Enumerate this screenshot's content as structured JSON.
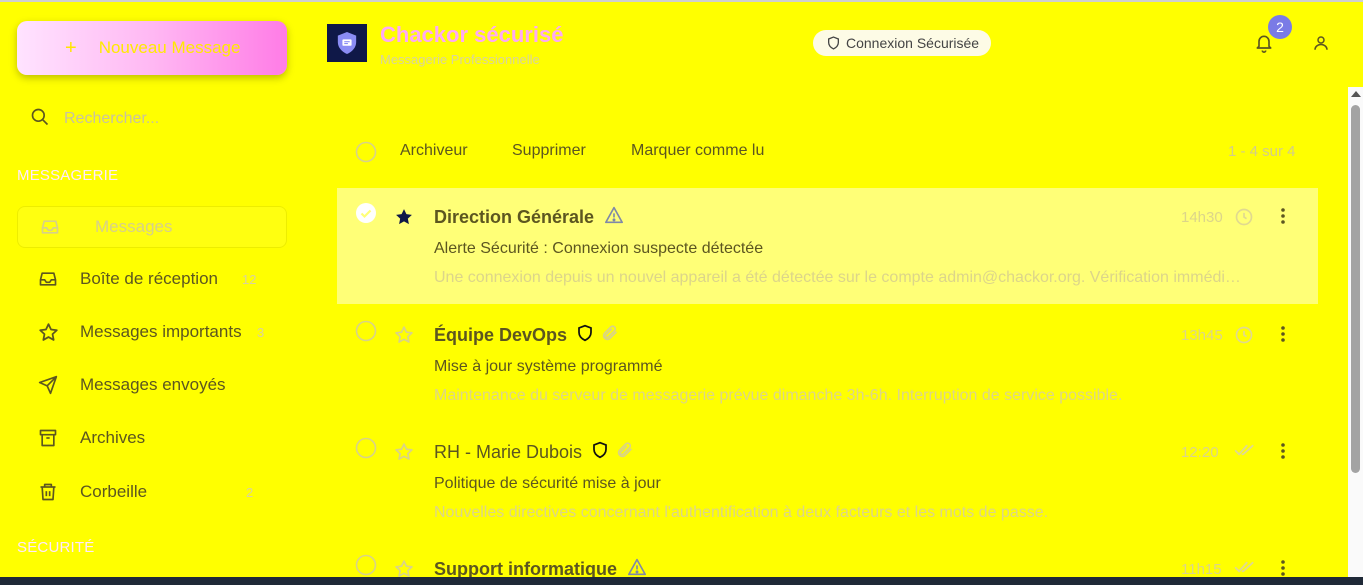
{
  "app": {
    "title": "Chackor sécurisé",
    "subtitle": "Messagerie Professionnelle",
    "security_status": "Connexion Sécurisée",
    "notification_count": "2"
  },
  "sidebar": {
    "compose_plus": "+",
    "compose_label": "Nouveau Message",
    "search_placeholder": "Rechercher...",
    "section_messaging": "MESSAGERIE",
    "section_security": "SÉCURITÉ",
    "items": [
      {
        "label": "Messages",
        "count": "",
        "icon": "inbox-icon",
        "active": true
      },
      {
        "label": "Boîte de réception",
        "count": "12",
        "icon": "inbox-icon"
      },
      {
        "label": "Messages importants",
        "count": "3",
        "icon": "star-icon"
      },
      {
        "label": "Messages envoyés",
        "count": "",
        "icon": "send-icon"
      },
      {
        "label": "Archives",
        "count": "",
        "icon": "archive-icon"
      },
      {
        "label": "Corbeille",
        "count": "2",
        "icon": "trash-icon"
      }
    ]
  },
  "toolbar": {
    "archive_label": "Archiveur",
    "delete_label": "Supprimer",
    "mark_read_label": "Marquer comme lu",
    "pagination": "1 - 4 sur 4"
  },
  "messages": [
    {
      "sender": "Direction Générale",
      "subject": "Alerte Sécurité : Connexion suspecte détectée",
      "preview": "Une connexion depuis un nouvel appareil a été détectée sur le compte admin@chackor.org. Vérification immédiate requise.",
      "time": "14h30",
      "starred": true,
      "selected": true,
      "tags": [
        "warning-icon"
      ],
      "status": "clock-icon"
    },
    {
      "sender": "Équipe DevOps",
      "subject": "Mise à jour système programmé",
      "preview": "Maintenance du serveur de messagerie prévue dimanche 3h-6h. Interruption de service possible.",
      "time": "13h45",
      "starred": false,
      "selected": false,
      "tags": [
        "shield-icon",
        "paperclip-icon"
      ],
      "status": "clock-icon"
    },
    {
      "sender": "RH - Marie Dubois",
      "subject": "Politique de sécurité mise à jour",
      "preview": "Nouvelles directives concernant l'authentification à deux facteurs et les mots de passe.",
      "time": "12:20",
      "starred": false,
      "selected": false,
      "tags": [
        "shield-icon",
        "paperclip-icon"
      ],
      "status": "double-check-icon"
    },
    {
      "sender": "Support informatique",
      "subject": "",
      "preview": "",
      "time": "11h15",
      "starred": false,
      "selected": false,
      "tags": [
        "warning-icon"
      ],
      "status": "double-check-icon"
    }
  ],
  "colors": {
    "background": "#ffff00",
    "selected_row": "#ffff77",
    "compose_gradient_end": "#ff7ce6",
    "badge": "#7a7be6",
    "logo_bg": "#0f1848"
  }
}
